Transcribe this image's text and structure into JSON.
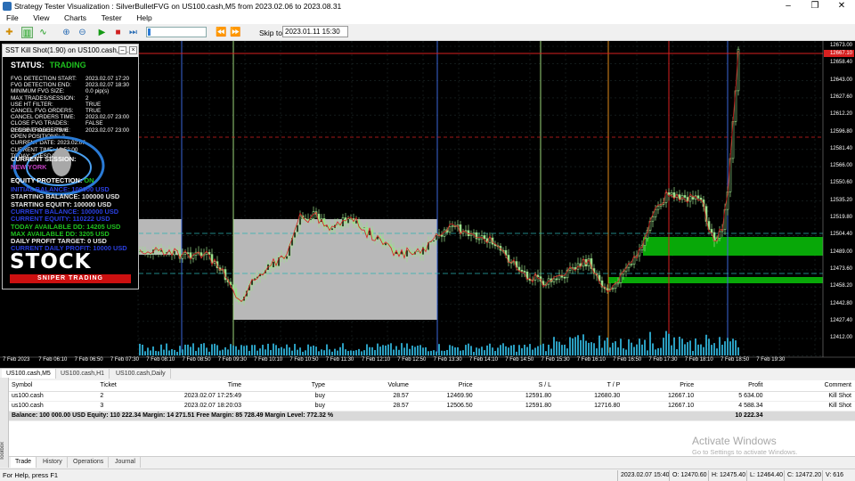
{
  "window": {
    "title": "Strategy Tester Visualization : SilverBulletFVG on US100.cash,M5 from 2023.02.06 to 2023.08.31",
    "minimize": "–",
    "maximize": "❐",
    "close": "✕"
  },
  "menu": [
    "File",
    "View",
    "Charts",
    "Tester",
    "Help"
  ],
  "toolbar": {
    "skip_to_label": "Skip to",
    "skip_to_value": "2023.01.11 15:30",
    "progress_fraction": 0.05
  },
  "panel": {
    "header": "SST Kill Shot(1.90) on US100.cash,5 ...",
    "status_label": "STATUS:",
    "status_value": "TRADING",
    "params": [
      {
        "k": "FVG DETECTION START:",
        "v": "2023.02.07 17:20"
      },
      {
        "k": "FVG DETECTION END:",
        "v": "2023.02.07 18:30"
      },
      {
        "k": "MINIMUM FVG SIZE:",
        "v": "0.0 pip(s)"
      },
      {
        "k": "MAX TRADES/SESSION:",
        "v": "2"
      },
      {
        "k": "USE HT FILTER:",
        "v": "TRUE"
      },
      {
        "k": "CANCEL FVG ORDERS:",
        "v": "TRUE"
      },
      {
        "k": "CANCEL ORDERS TIME:",
        "v": "2023.02.07 23:00"
      },
      {
        "k": "CLOSE FVG TRADES:",
        "v": "FALSE"
      },
      {
        "k": "CLOSE TRADES TIME:",
        "v": "2023.02.07 23:00"
      }
    ],
    "info": [
      "PENDING ORDERS: 0",
      "OPEN POSITIONS: 2",
      "CURRENT DATE: 2023.02.07",
      "CURRENT TIME: 19:52:00",
      "TODAY: TUESDAY"
    ],
    "session_label": "CURRENT SESSION:",
    "session_value": "NEW YORK",
    "equity_label": "EQUITY PROTECTION:",
    "equity_value": "ON",
    "lines": [
      {
        "text": "INITIAL BALANCE: 100000 USD",
        "color": "#2a3fe0"
      },
      {
        "text": "STARTING BALANCE: 100000 USD",
        "color": "#e8e8e8"
      },
      {
        "text": "STARTING EQUITY: 100000 USD",
        "color": "#e8e8e8"
      },
      {
        "text": "CURRENT BALANCE: 100000 USD",
        "color": "#2a3fe0"
      },
      {
        "text": "CURRENT EQUITY: 110222 USD",
        "color": "#2a3fe0"
      },
      {
        "text": "TODAY AVAILABLE DD: 14205 USD",
        "color": "#1fc21f"
      },
      {
        "text": "MAX AVAILABLE DD: 3205 USD",
        "color": "#1fc21f"
      },
      {
        "text": "DAILY PROFIT TARGET: 0 USD",
        "color": "#e8e8e8"
      },
      {
        "text": "CURRENT DAILY PROFIT: 10000 USD",
        "color": "#2a3fe0"
      }
    ],
    "logo_main": "STOCK",
    "logo_sub": "SNIPER TRADING"
  },
  "chart": {
    "bid_line_price": "12667.10",
    "price_labels": [
      "12673.00",
      "12658.40",
      "12643.00",
      "12627.60",
      "12612.20",
      "12596.80",
      "12581.40",
      "12566.00",
      "12550.60",
      "12535.20",
      "12519.80",
      "12504.40",
      "12489.00",
      "12473.60",
      "12458.20",
      "12442.80",
      "12427.40",
      "12412.00"
    ],
    "time_labels": [
      "7 Feb 2023",
      "7 Feb 06:10",
      "7 Feb 06:50",
      "7 Feb 07:30",
      "7 Feb 08:10",
      "7 Feb 08:50",
      "7 Feb 09:30",
      "7 Feb 10:10",
      "7 Feb 10:50",
      "7 Feb 11:30",
      "7 Feb 12:10",
      "7 Feb 12:50",
      "7 Feb 13:30",
      "7 Feb 14:10",
      "7 Feb 14:50",
      "7 Feb 15:30",
      "7 Feb 16:10",
      "7 Feb 16:50",
      "7 Feb 17:30",
      "7 Feb 18:10",
      "7 Feb 18:50",
      "7 Feb 19:30"
    ]
  },
  "chart_tabs": [
    "US100.cash,M5",
    "US100.cash,H1",
    "US100.cash,Daily"
  ],
  "toolbox_label": "Toolbox",
  "trade_table": {
    "columns": [
      "Symbol",
      "Ticket",
      "Time",
      "Type",
      "Volume",
      "Price",
      "S / L",
      "T / P",
      "Price",
      "Profit",
      "Comment"
    ],
    "rows": [
      [
        "us100.cash",
        "2",
        "2023.02.07 17:25:49",
        "buy",
        "28.57",
        "12469.90",
        "12591.80",
        "12680.30",
        "12667.10",
        "5 634.00",
        "Kill Shot"
      ],
      [
        "us100.cash",
        "3",
        "2023.02.07 18:20:03",
        "buy",
        "28.57",
        "12506.50",
        "12591.80",
        "12716.80",
        "12667.10",
        "4 588.34",
        "Kill Shot"
      ]
    ],
    "balance_line": "Balance: 100 000.00 USD  Equity: 110 222.34  Margin: 14 271.51  Free Margin: 85 728.49  Margin Level: 772.32 %",
    "balance_profit": "10 222.34"
  },
  "watermark": {
    "title": "Activate Windows",
    "sub": "Go to Settings to activate Windows."
  },
  "bottom_tabs": [
    "Trade",
    "History",
    "Operations",
    "Journal"
  ],
  "statusbar": {
    "help": "For Help, press F1",
    "datetime": "2023.02.07 15:40",
    "open": "O: 12470.60",
    "high": "H: 12475.40",
    "low": "L: 12464.40",
    "close": "C: 12472.20",
    "volume": "V: 616"
  }
}
